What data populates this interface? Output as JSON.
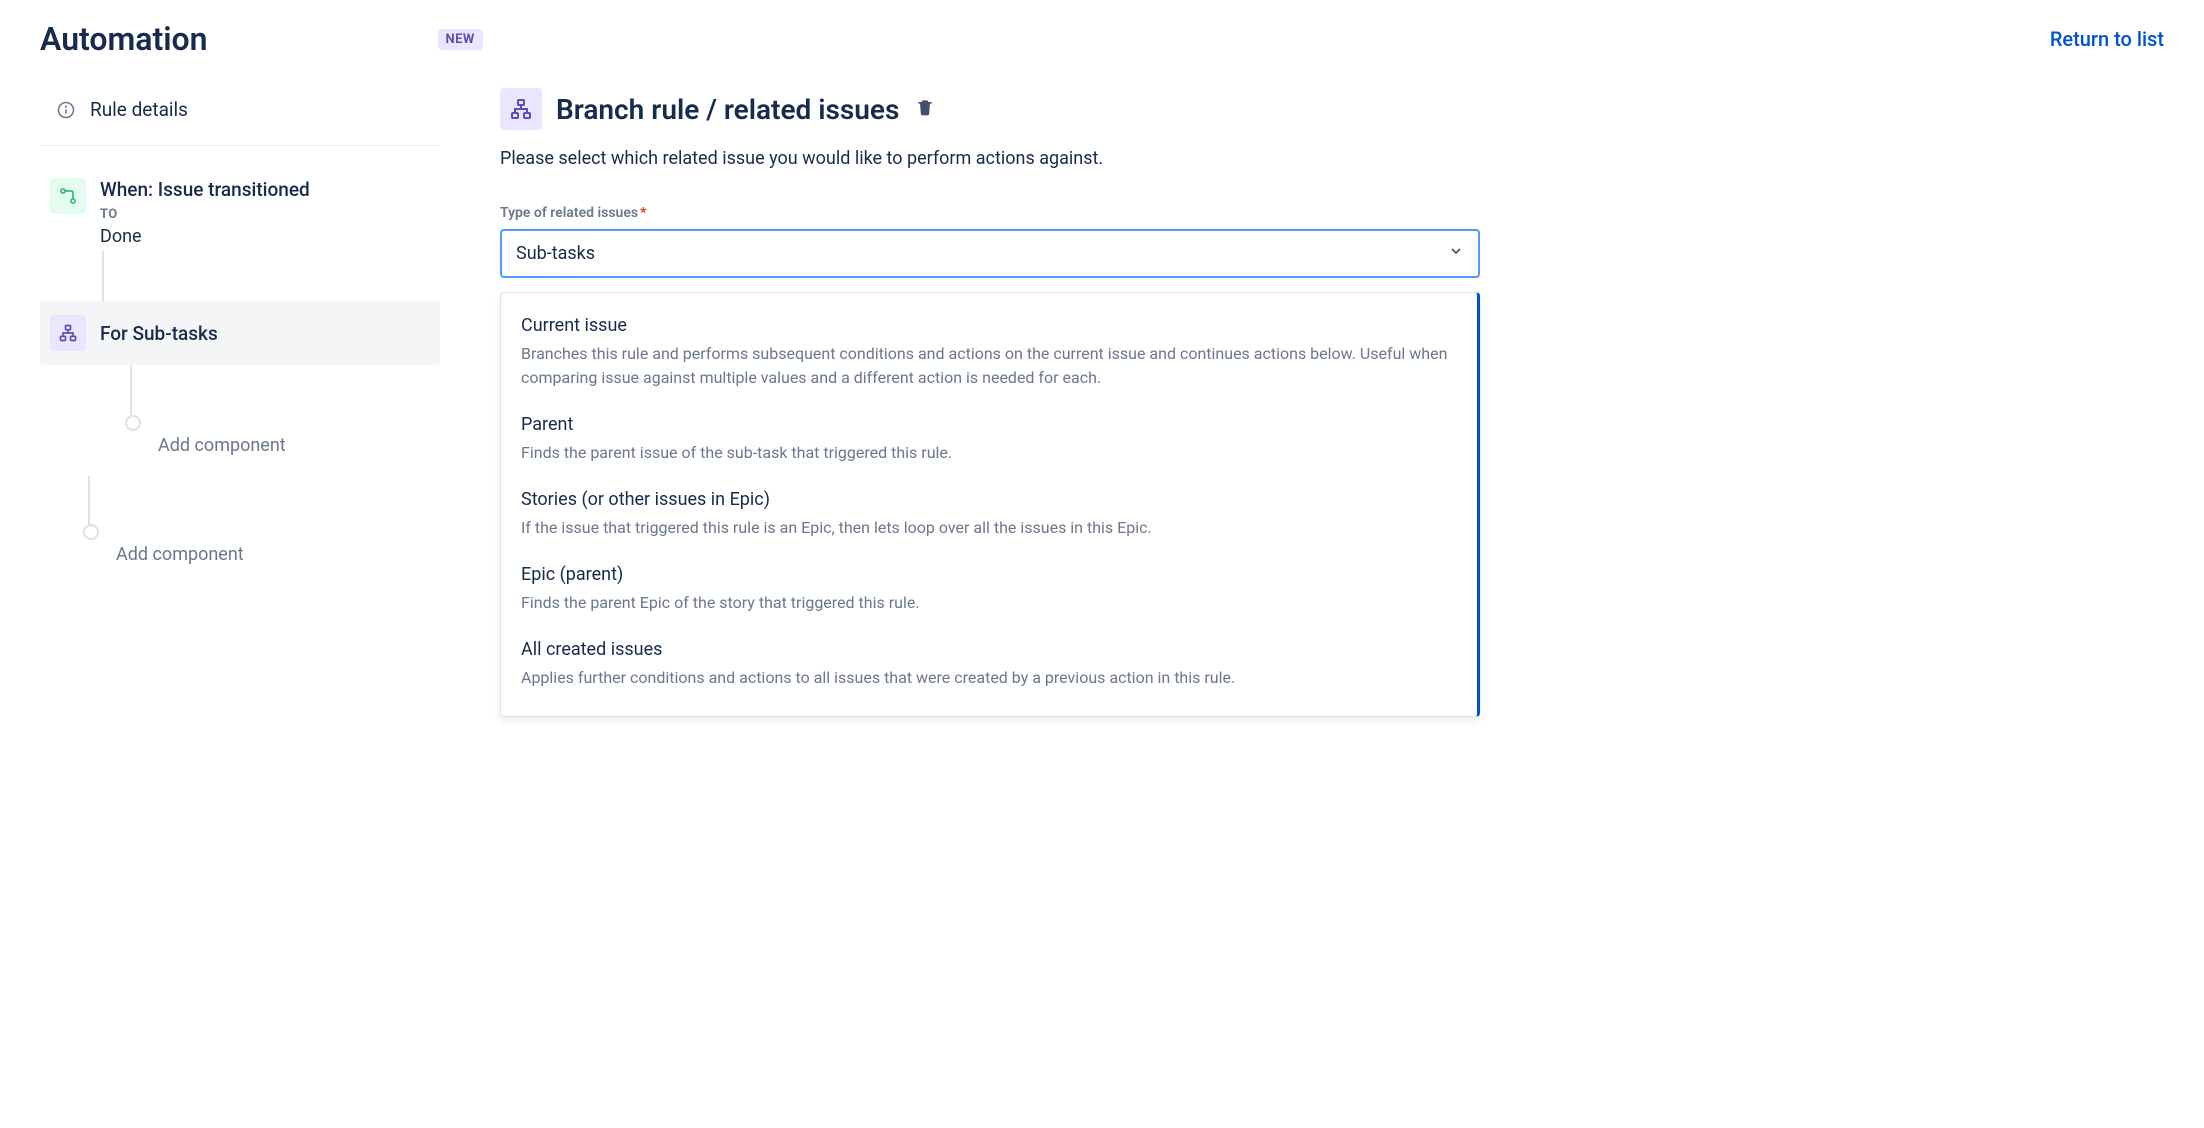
{
  "header": {
    "title": "Automation",
    "badge": "NEW",
    "return_link": "Return to list"
  },
  "sidebar": {
    "rule_details": "Rule details",
    "trigger": {
      "title": "When: Issue transitioned",
      "sub_label": "TO",
      "value": "Done"
    },
    "branch": {
      "label": "For Sub-tasks"
    },
    "add_component_inner": "Add component",
    "add_component_outer": "Add component"
  },
  "main": {
    "heading": "Branch rule / related issues",
    "description": "Please select which related issue you would like to perform actions against.",
    "field_label": "Type of related issues",
    "select_value": "Sub-tasks",
    "options": [
      {
        "title": "Current issue",
        "desc": "Branches this rule and performs subsequent conditions and actions on the current issue and continues actions below. Useful when comparing issue against multiple values and a different action is needed for each."
      },
      {
        "title": "Parent",
        "desc": "Finds the parent issue of the sub-task that triggered this rule."
      },
      {
        "title": "Stories (or other issues in Epic)",
        "desc": "If the issue that triggered this rule is an Epic, then lets loop over all the issues in this Epic."
      },
      {
        "title": "Epic (parent)",
        "desc": "Finds the parent Epic of the story that triggered this rule."
      },
      {
        "title": "All created issues",
        "desc": "Applies further conditions and actions to all issues that were created by a previous action in this rule."
      }
    ]
  }
}
